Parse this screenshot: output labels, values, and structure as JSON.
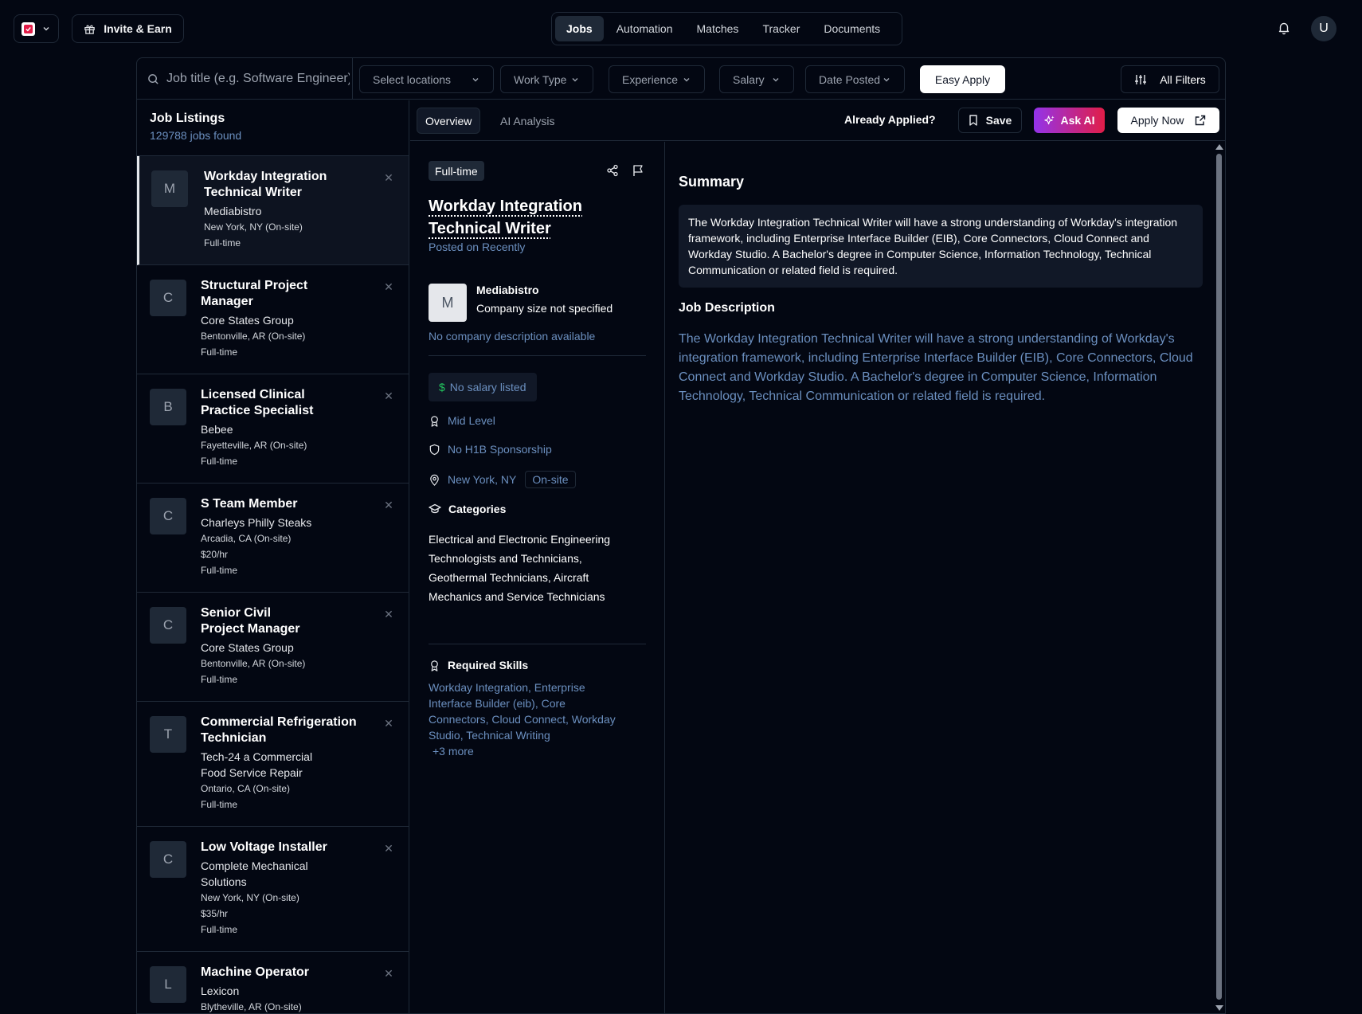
{
  "topbar": {
    "invite_label": "Invite & Earn",
    "nav": [
      "Jobs",
      "Automation",
      "Matches",
      "Tracker",
      "Documents"
    ],
    "active_nav": "Jobs",
    "avatar_initial": "U"
  },
  "filters": {
    "search_placeholder": "Job title (e.g. Software Engineer)",
    "locations": "Select locations",
    "work_type": "Work Type",
    "experience": "Experience",
    "salary": "Salary",
    "date_posted": "Date Posted",
    "easy_apply": "Easy Apply",
    "all_filters": "All Filters"
  },
  "listings": {
    "title": "Job Listings",
    "count": "129788 jobs found",
    "jobs": [
      {
        "initial": "M",
        "title": "Workday Integration Technical Writer",
        "company": "Mediabistro",
        "location": "New York, NY (On-site)",
        "pay": "",
        "type": "Full-time"
      },
      {
        "initial": "C",
        "title": "Structural Project Manager",
        "company": "Core States Group",
        "location": "Bentonville, AR (On-site)",
        "pay": "",
        "type": "Full-time"
      },
      {
        "initial": "B",
        "title": "Licensed Clinical Practice Specialist",
        "company": "Bebee",
        "location": "Fayetteville, AR (On-site)",
        "pay": "",
        "type": "Full-time"
      },
      {
        "initial": "C",
        "title": "S Team Member",
        "company": "Charleys Philly Steaks",
        "location": "Arcadia, CA (On-site)",
        "pay": "$20/hr",
        "type": "Full-time"
      },
      {
        "initial": "C",
        "title": "Senior Civil Project Manager",
        "company": "Core States Group",
        "location": "Bentonville, AR (On-site)",
        "pay": "",
        "type": "Full-time"
      },
      {
        "initial": "T",
        "title": "Commercial Refrigeration Technician",
        "company": "Tech-24 a Commercial Food Service Repair",
        "location": "Ontario, CA (On-site)",
        "pay": "",
        "type": "Full-time"
      },
      {
        "initial": "C",
        "title": "Low Voltage Installer",
        "company": "Complete Mechanical Solutions",
        "location": "New York, NY (On-site)",
        "pay": "$35/hr",
        "type": "Full-time"
      },
      {
        "initial": "L",
        "title": "Machine Operator",
        "company": "Lexicon",
        "location": "Blytheville, AR (On-site)",
        "pay": "",
        "type": ""
      }
    ]
  },
  "detail": {
    "tabs": [
      "Overview",
      "AI Analysis"
    ],
    "already_applied": "Already Applied?",
    "save": "Save",
    "ask_ai": "Ask AI",
    "apply_now": "Apply Now",
    "badge": "Full-time",
    "title": "Workday Integration Technical Writer",
    "posted": "Posted on Recently",
    "company_initial": "M",
    "company_name": "Mediabistro",
    "company_size": "Company size not specified",
    "company_desc": "No company description available",
    "salary": "No salary listed",
    "level": "Mid Level",
    "sponsorship": "No H1B Sponsorship",
    "location": "New York, NY",
    "workplace": "On-site",
    "categories_h": "Categories",
    "categories": "Electrical and Electronic Engineering Technologists and Technicians, Geothermal Technicians, Aircraft Mechanics and Service Technicians",
    "skills_h": "Required Skills",
    "skills": "Workday Integration, Enterprise Interface Builder (eib), Core Connectors, Cloud Connect, Workday Studio, Technical Writing",
    "skills_more": "+3 more",
    "summary_h": "Summary",
    "summary": "The Workday Integration Technical Writer will have a strong understanding of Workday's integration framework, including Enterprise Interface Builder (EIB), Core Connectors, Cloud Connect and Workday Studio. A Bachelor's degree in Computer Science, Information Technology, Technical Communication or related field is required.",
    "jd_h": "Job Description",
    "jd": "The Workday Integration Technical Writer will have a strong understanding of Workday's integration framework, including Enterprise Interface Builder (EIB), Core Connectors, Cloud Connect and Workday Studio. A Bachelor's degree in Computer Science, Information Technology, Technical Communication or related field is required."
  }
}
